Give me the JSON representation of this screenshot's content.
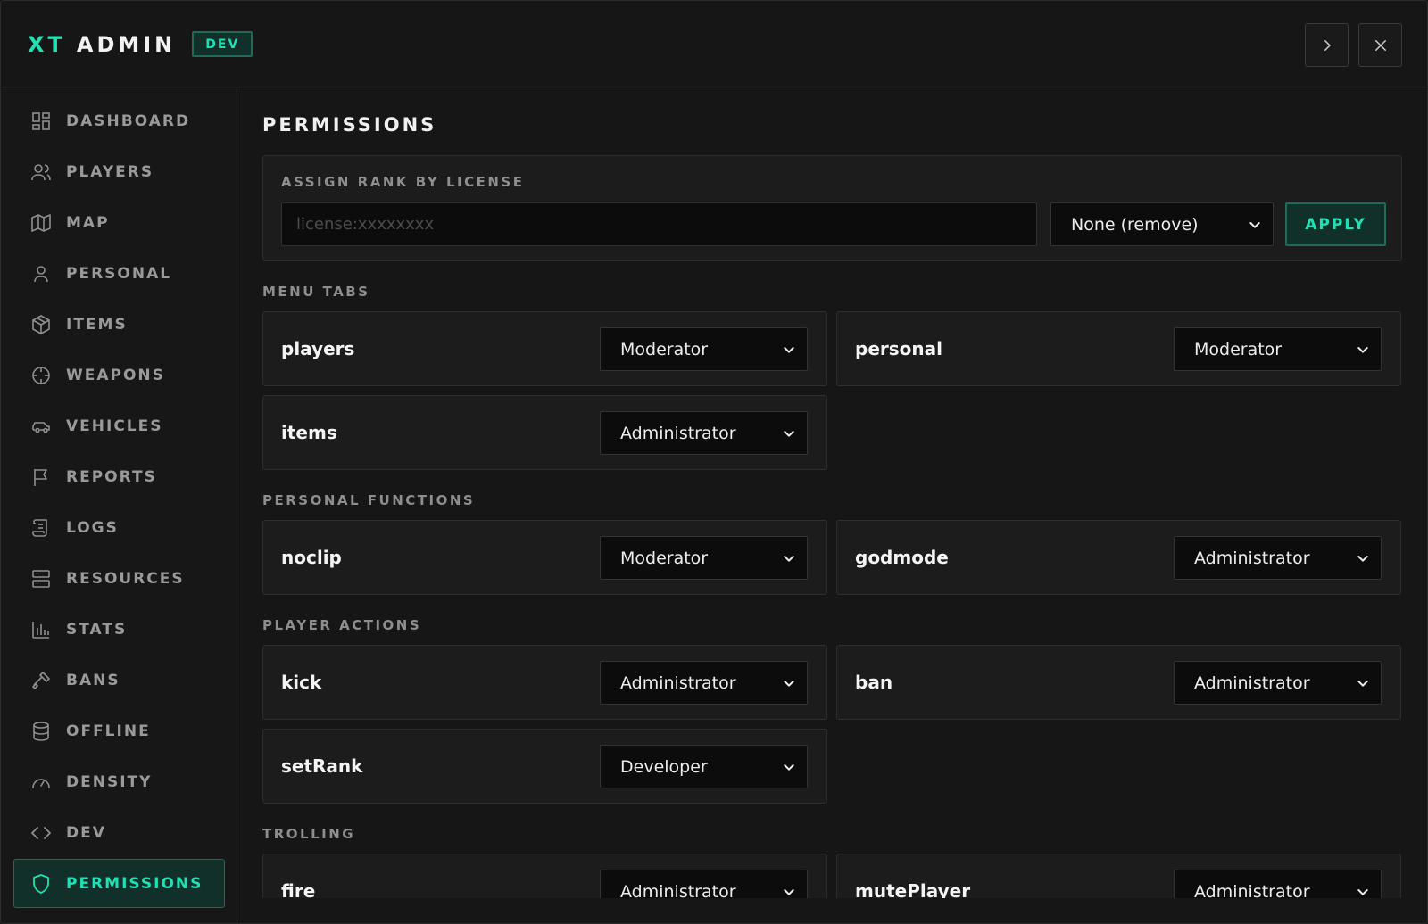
{
  "header": {
    "brand_accent": "XT",
    "brand_text": "ADMIN",
    "env_badge": "DEV"
  },
  "sidebar": {
    "items": [
      {
        "label": "DASHBOARD",
        "icon": "dashboard-icon"
      },
      {
        "label": "PLAYERS",
        "icon": "users-icon"
      },
      {
        "label": "MAP",
        "icon": "map-icon"
      },
      {
        "label": "PERSONAL",
        "icon": "user-icon"
      },
      {
        "label": "ITEMS",
        "icon": "box-icon"
      },
      {
        "label": "WEAPONS",
        "icon": "crosshair-icon"
      },
      {
        "label": "VEHICLES",
        "icon": "car-icon"
      },
      {
        "label": "REPORTS",
        "icon": "flag-icon"
      },
      {
        "label": "LOGS",
        "icon": "scroll-icon"
      },
      {
        "label": "RESOURCES",
        "icon": "server-icon"
      },
      {
        "label": "STATS",
        "icon": "bar-chart-icon"
      },
      {
        "label": "BANS",
        "icon": "gavel-icon"
      },
      {
        "label": "OFFLINE",
        "icon": "database-icon"
      },
      {
        "label": "DENSITY",
        "icon": "gauge-icon"
      },
      {
        "label": "DEV",
        "icon": "code-icon"
      },
      {
        "label": "PERMISSIONS",
        "icon": "shield-icon",
        "active": true
      }
    ]
  },
  "main": {
    "title": "PERMISSIONS",
    "assign": {
      "label": "ASSIGN RANK BY LICENSE",
      "input_placeholder": "license:xxxxxxxx",
      "input_value": "",
      "rank_selected": "None (remove)",
      "apply_label": "APPLY"
    },
    "sections": {
      "menu_tabs": {
        "title": "MENU TABS",
        "items": [
          {
            "name": "players",
            "rank": "Moderator"
          },
          {
            "name": "personal",
            "rank": "Moderator"
          },
          {
            "name": "items",
            "rank": "Administrator"
          }
        ]
      },
      "personal_functions": {
        "title": "PERSONAL FUNCTIONS",
        "items": [
          {
            "name": "noclip",
            "rank": "Moderator"
          },
          {
            "name": "godmode",
            "rank": "Administrator"
          }
        ]
      },
      "player_actions": {
        "title": "PLAYER ACTIONS",
        "items": [
          {
            "name": "kick",
            "rank": "Administrator"
          },
          {
            "name": "ban",
            "rank": "Administrator"
          },
          {
            "name": "setRank",
            "rank": "Developer"
          }
        ]
      },
      "trolling": {
        "title": "TROLLING",
        "items": [
          {
            "name": "fire",
            "rank": "Administrator"
          },
          {
            "name": "mutePlayer",
            "rank": "Administrator"
          }
        ]
      }
    }
  },
  "colors": {
    "accent": "#20e0b4",
    "background": "#161616",
    "card": "#1c1c1c"
  }
}
